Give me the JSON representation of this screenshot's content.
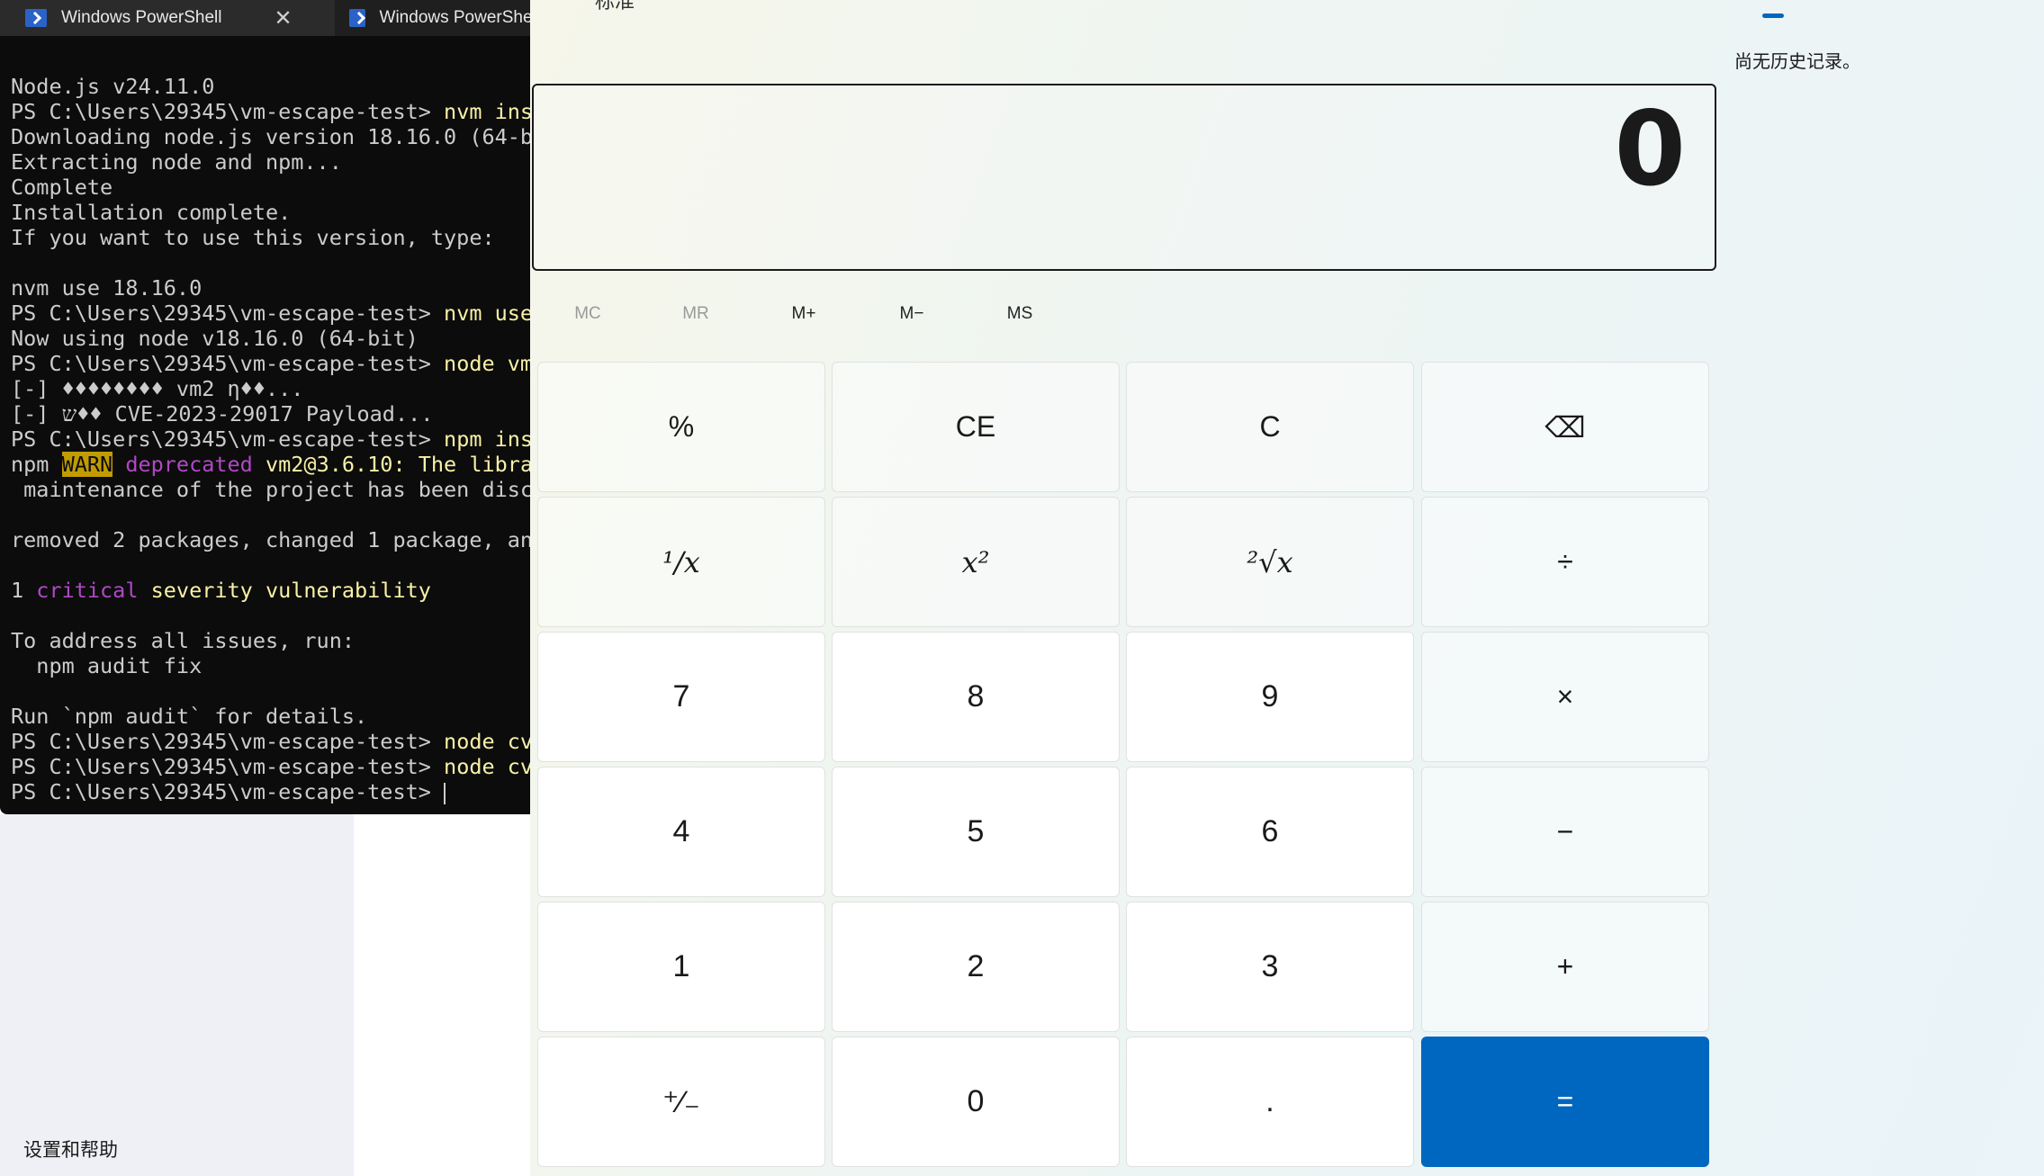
{
  "terminal": {
    "tabs": [
      {
        "label": "Windows PowerShell",
        "active": false
      },
      {
        "label": "Windows PowerShell",
        "active": true
      }
    ],
    "lines": [
      "Node.js v24.11.0",
      "PS C:\\Users\\29345\\vm-escape-test> |nvm ins",
      "Downloading node.js version 18.16.0 (64-bi",
      "Extracting node and npm...",
      "Complete",
      "Installation complete.",
      "If you want to use this version, type:",
      "",
      "nvm use 18.16.0",
      "PS C:\\Users\\29345\\vm-escape-test> |nvm use",
      "Now using node v18.16.0 (64-bit)",
      "PS C:\\Users\\29345\\vm-escape-test> |node vm",
      "[-] ♦♦♦♦♦♦♦♦ vm2 η♦♦...",
      "[-] ש♦♦ CVE-2023-29017 Payload...",
      "PS C:\\Users\\29345\\vm-escape-test> |npm ins",
      "npm |WARN| |deprecated| vm2@3.6.10: The libra",
      " maintenance of the project has been disc",
      "",
      "removed 2 packages, changed 1 package, an",
      "",
      "1 |critical| severity vulnerability",
      "",
      "To address all issues, run:",
      "  npm audit fix",
      "",
      "Run `npm audit` for details.",
      "PS C:\\Users\\29345\\vm-escape-test> |node cv",
      "PS C:\\Users\\29345\\vm-escape-test> |node cv",
      "PS C:\\Users\\29345\\vm-escape-test> "
    ]
  },
  "background": {
    "settings_help": "设置和帮助"
  },
  "calculator": {
    "title": "标准",
    "display": "0",
    "memory": [
      "MC",
      "MR",
      "M+",
      "M−",
      "MS"
    ],
    "keys": [
      [
        "%",
        "CE",
        "C",
        "⌫"
      ],
      [
        "¹∕x",
        "x²",
        "²√x",
        "÷"
      ],
      [
        "7",
        "8",
        "9",
        "×"
      ],
      [
        "4",
        "5",
        "6",
        "−"
      ],
      [
        "1",
        "2",
        "3",
        "+"
      ],
      [
        "⁺∕₋",
        "0",
        ".",
        "="
      ]
    ],
    "accent": "#0067c0"
  },
  "history": {
    "empty_text": "尚无历史记录。"
  }
}
